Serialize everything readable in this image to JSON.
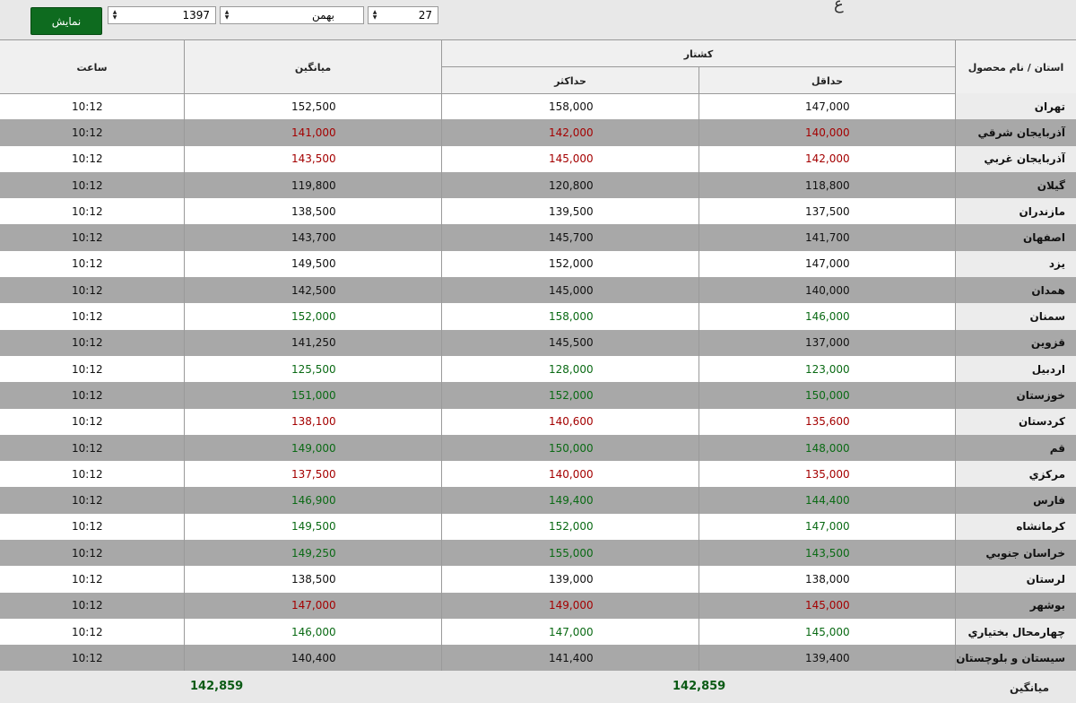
{
  "toolbar": {
    "show_label": "نمایش",
    "year": "1397",
    "month": "بهمن",
    "day": "27",
    "title_fragment": "ع"
  },
  "table": {
    "headers": {
      "province": "استان / نام محصول",
      "group": "کشتار",
      "min": "حداقل",
      "max": "حداکثر",
      "avg": "میانگین",
      "time": "ساعت"
    },
    "rows": [
      {
        "province": "تهران",
        "min": "147,000",
        "max": "158,000",
        "avg": "152,500",
        "time": "10:12",
        "tone": ""
      },
      {
        "province": "آذربایجان شرقي",
        "min": "140,000",
        "max": "142,000",
        "avg": "141,000",
        "time": "10:12",
        "tone": "red"
      },
      {
        "province": "آذربایجان غربي",
        "min": "142,000",
        "max": "145,000",
        "avg": "143,500",
        "time": "10:12",
        "tone": "red"
      },
      {
        "province": "گیلان",
        "min": "118,800",
        "max": "120,800",
        "avg": "119,800",
        "time": "10:12",
        "tone": ""
      },
      {
        "province": "مازندران",
        "min": "137,500",
        "max": "139,500",
        "avg": "138,500",
        "time": "10:12",
        "tone": ""
      },
      {
        "province": "اصفهان",
        "min": "141,700",
        "max": "145,700",
        "avg": "143,700",
        "time": "10:12",
        "tone": ""
      },
      {
        "province": "یزد",
        "min": "147,000",
        "max": "152,000",
        "avg": "149,500",
        "time": "10:12",
        "tone": ""
      },
      {
        "province": "همدان",
        "min": "140,000",
        "max": "145,000",
        "avg": "142,500",
        "time": "10:12",
        "tone": ""
      },
      {
        "province": "سمنان",
        "min": "146,000",
        "max": "158,000",
        "avg": "152,000",
        "time": "10:12",
        "tone": "green"
      },
      {
        "province": "قزوین",
        "min": "137,000",
        "max": "145,500",
        "avg": "141,250",
        "time": "10:12",
        "tone": ""
      },
      {
        "province": "اردبیل",
        "min": "123,000",
        "max": "128,000",
        "avg": "125,500",
        "time": "10:12",
        "tone": "green"
      },
      {
        "province": "خوزستان",
        "min": "150,000",
        "max": "152,000",
        "avg": "151,000",
        "time": "10:12",
        "tone": "green"
      },
      {
        "province": "کردستان",
        "min": "135,600",
        "max": "140,600",
        "avg": "138,100",
        "time": "10:12",
        "tone": "red"
      },
      {
        "province": "قم",
        "min": "148,000",
        "max": "150,000",
        "avg": "149,000",
        "time": "10:12",
        "tone": "green"
      },
      {
        "province": "مرکزي",
        "min": "135,000",
        "max": "140,000",
        "avg": "137,500",
        "time": "10:12",
        "tone": "red"
      },
      {
        "province": "فارس",
        "min": "144,400",
        "max": "149,400",
        "avg": "146,900",
        "time": "10:12",
        "tone": "green"
      },
      {
        "province": "کرمانشاه",
        "min": "147,000",
        "max": "152,000",
        "avg": "149,500",
        "time": "10:12",
        "tone": "green"
      },
      {
        "province": "خراسان جنوبي",
        "min": "143,500",
        "max": "155,000",
        "avg": "149,250",
        "time": "10:12",
        "tone": "green"
      },
      {
        "province": "لرستان",
        "min": "138,000",
        "max": "139,000",
        "avg": "138,500",
        "time": "10:12",
        "tone": ""
      },
      {
        "province": "بوشهر",
        "min": "145,000",
        "max": "149,000",
        "avg": "147,000",
        "time": "10:12",
        "tone": "red"
      },
      {
        "province": "چهارمحال بختیاري",
        "min": "145,000",
        "max": "147,000",
        "avg": "146,000",
        "time": "10:12",
        "tone": "green"
      },
      {
        "province": "سیستان و بلوچستان",
        "min": "139,400",
        "max": "141,400",
        "avg": "140,400",
        "time": "10:12",
        "tone": ""
      }
    ],
    "footer": {
      "label": "میانگین",
      "avg_kashtar": "142,859",
      "avg_overall": "142,859"
    }
  },
  "colors": {
    "button_green": "#0e6b1f",
    "row_alt": "#a8a8a8",
    "value_red": "#a40000",
    "value_green": "#0a6a14"
  }
}
